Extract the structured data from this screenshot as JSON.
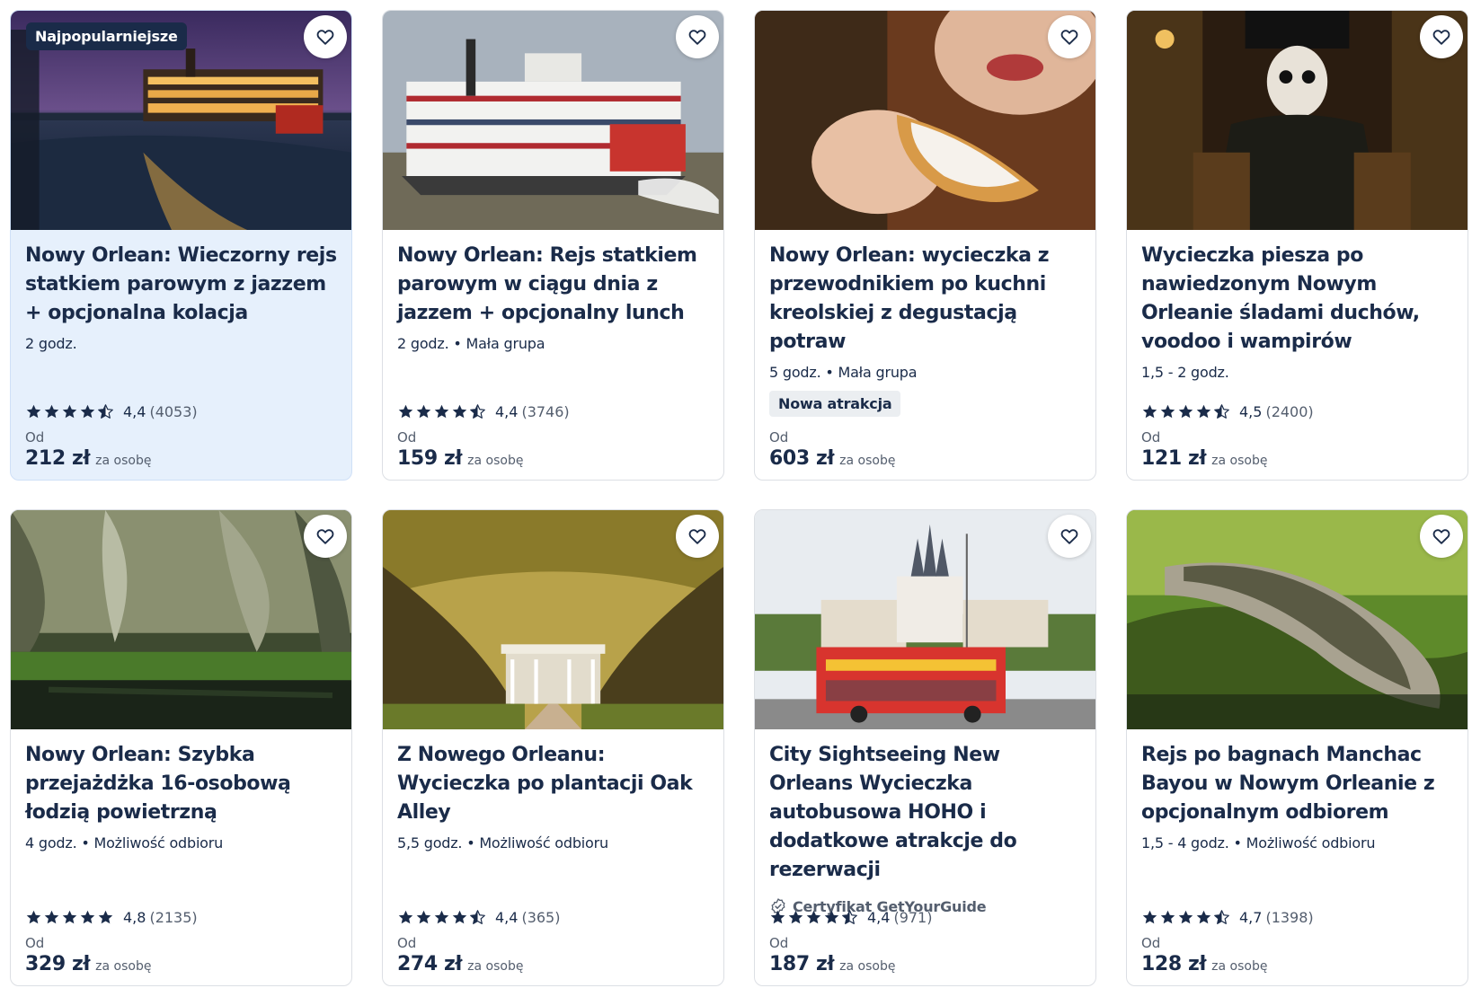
{
  "colors": {
    "brand_dark": "#1a2b49",
    "highlight_card": "#e6f0fc",
    "tag_bg": "#ebeef1",
    "text_muted": "#545e6e"
  },
  "icons": {
    "favorite": "heart-outline-icon",
    "star": "star-icon",
    "certified": "certified-badge-icon"
  },
  "cards": [
    {
      "badge": "Najpopularniejsze",
      "title": "Nowy Orlean: Wieczorny rejs statkiem parowym z jazzem + opcjonalna kolacja",
      "meta": "2 godz.",
      "rating": "4,4",
      "stars": 4.5,
      "reviews": "(4053)",
      "from": "Od",
      "price": "212 zł",
      "per": "za osobę",
      "highlight": true
    },
    {
      "title": "Nowy Orlean: Rejs statkiem parowym w ciągu dnia z jazzem + opcjonalny lunch",
      "meta": "2 godz. • Mała grupa",
      "rating": "4,4",
      "stars": 4.5,
      "reviews": "(3746)",
      "from": "Od",
      "price": "159 zł",
      "per": "za osobę"
    },
    {
      "title": "Nowy Orlean: wycieczka z przewodnikiem po kuchni kreolskiej z degustacją potraw",
      "meta": "5 godz. • Mała grupa",
      "tag": "Nowa atrakcja",
      "from": "Od",
      "price": "603 zł",
      "per": "za osobę"
    },
    {
      "title": "Wycieczka piesza po nawiedzonym Nowym Orleanie śladami duchów, voodoo i wampirów",
      "meta": "1,5 - 2 godz.",
      "rating": "4,5",
      "stars": 4.5,
      "reviews": "(2400)",
      "from": "Od",
      "price": "121 zł",
      "per": "za osobę"
    },
    {
      "title": "Nowy Orlean: Szybka przejażdżka 16-osobową łodzią powietrzną",
      "meta": "4 godz. • Możliwość odbioru",
      "rating": "4,8",
      "stars": 5,
      "reviews": "(2135)",
      "from": "Od",
      "price": "329 zł",
      "per": "za osobę"
    },
    {
      "title": "Z Nowego Orleanu: Wycieczka po plantacji Oak Alley",
      "meta": "5,5 godz. • Możliwość odbioru",
      "rating": "4,4",
      "stars": 4.5,
      "reviews": "(365)",
      "from": "Od",
      "price": "274 zł",
      "per": "za osobę"
    },
    {
      "title": "City Sightseeing New Orleans Wycieczka autobusowa HOHO i dodatkowe atrakcje do rezerwacji",
      "certificate": "Certyfikat GetYourGuide",
      "rating": "4,4",
      "stars": 4.5,
      "reviews": "(971)",
      "from": "Od",
      "price": "187 zł",
      "per": "za osobę"
    },
    {
      "title": "Rejs po bagnach Manchac Bayou w Nowym Orleanie z opcjonalnym odbiorem",
      "meta": "1,5 - 4 godz. • Możliwość odbioru",
      "rating": "4,7",
      "stars": 4.5,
      "reviews": "(1398)",
      "from": "Od",
      "price": "128 zł",
      "per": "za osobę"
    }
  ]
}
